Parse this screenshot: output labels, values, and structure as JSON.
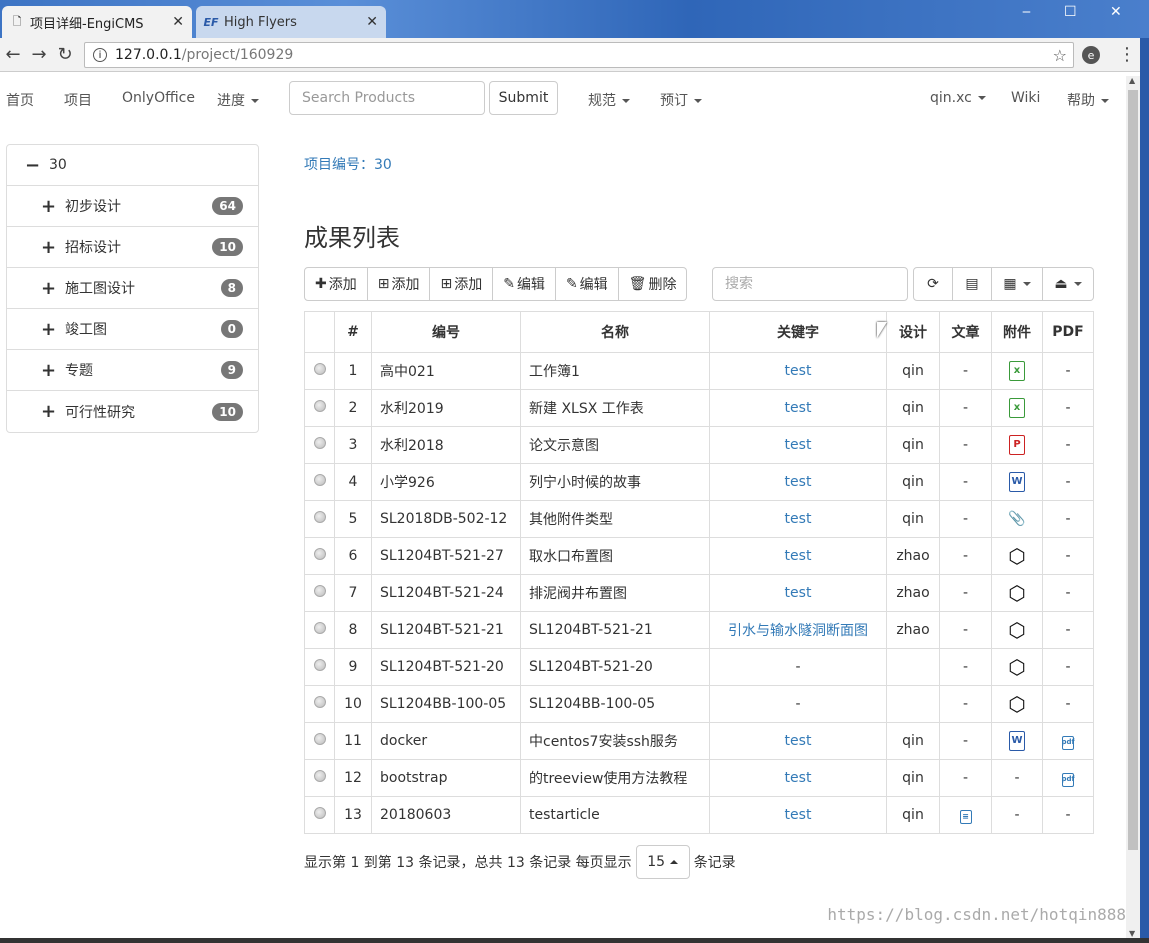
{
  "browser": {
    "tabs": [
      {
        "title": "项目详细-EngiCMS",
        "active": true
      },
      {
        "title": "High Flyers",
        "active": false
      }
    ],
    "url_host": "127.0.0.1",
    "url_path": "/project/160929"
  },
  "nav": {
    "home": "首页",
    "project": "项目",
    "onlyoffice": "OnlyOffice",
    "progress": "进度",
    "search_placeholder": "Search Products",
    "submit": "Submit",
    "standard": "规范",
    "reserve": "预订",
    "user": "qin.xc",
    "wiki": "Wiki",
    "help": "帮助"
  },
  "tree": {
    "root": "30",
    "children": [
      {
        "label": "初步设计",
        "count": "64"
      },
      {
        "label": "招标设计",
        "count": "10"
      },
      {
        "label": "施工图设计",
        "count": "8"
      },
      {
        "label": "竣工图",
        "count": "0"
      },
      {
        "label": "专题",
        "count": "9"
      },
      {
        "label": "可行性研究",
        "count": "10"
      }
    ]
  },
  "main": {
    "project_no": "项目编号：30",
    "heading": "成果列表",
    "toolbar": {
      "add1": "添加",
      "add2": "添加",
      "add3": "添加",
      "edit1": "编辑",
      "edit2": "编辑",
      "delete": "删除",
      "search_placeholder": "搜索"
    },
    "columns": [
      "#",
      "编号",
      "名称",
      "关键字",
      "设计",
      "文章",
      "附件",
      "PDF"
    ],
    "rows": [
      {
        "n": "1",
        "code": "高中021",
        "name": "工作簿1",
        "kw": "test",
        "designer": "qin",
        "article": "-",
        "att": "xlsx",
        "pdf": "-"
      },
      {
        "n": "2",
        "code": "水利2019",
        "name": "新建 XLSX 工作表",
        "kw": "test",
        "designer": "qin",
        "article": "-",
        "att": "xlsx",
        "pdf": "-"
      },
      {
        "n": "3",
        "code": "水利2018",
        "name": "论文示意图",
        "kw": "test",
        "designer": "qin",
        "article": "-",
        "att": "pptx",
        "pdf": "-"
      },
      {
        "n": "4",
        "code": "小学926",
        "name": "列宁小时候的故事",
        "kw": "test",
        "designer": "qin",
        "article": "-",
        "att": "docx",
        "pdf": "-"
      },
      {
        "n": "5",
        "code": "SL2018DB-502-12",
        "name": "其他附件类型",
        "kw": "test",
        "designer": "qin",
        "article": "-",
        "att": "clip",
        "pdf": "-"
      },
      {
        "n": "6",
        "code": "SL1204BT-521-27",
        "name": "取水口布置图",
        "kw": "test",
        "designer": "zhao",
        "article": "-",
        "att": "cube",
        "pdf": "-"
      },
      {
        "n": "7",
        "code": "SL1204BT-521-24",
        "name": "排泥阀井布置图",
        "kw": "test",
        "designer": "zhao",
        "article": "-",
        "att": "cube",
        "pdf": "-"
      },
      {
        "n": "8",
        "code": "SL1204BT-521-21",
        "name": "SL1204BT-521-21",
        "kw": "引水与输水隧洞断面图",
        "designer": "zhao",
        "article": "-",
        "att": "cube",
        "pdf": "-"
      },
      {
        "n": "9",
        "code": "SL1204BT-521-20",
        "name": "SL1204BT-521-20",
        "kw": "-",
        "designer": "",
        "article": "-",
        "att": "cube",
        "pdf": "-"
      },
      {
        "n": "10",
        "code": "SL1204BB-100-05",
        "name": "SL1204BB-100-05",
        "kw": "-",
        "designer": "",
        "article": "-",
        "att": "cube",
        "pdf": "-"
      },
      {
        "n": "11",
        "code": "docker",
        "name": "中centos7安装ssh服务",
        "kw": "test",
        "designer": "qin",
        "article": "-",
        "att": "docx",
        "pdf": "pdf"
      },
      {
        "n": "12",
        "code": "bootstrap",
        "name": "的treeview使用方法教程",
        "kw": "test",
        "designer": "qin",
        "article": "-",
        "att": "-",
        "pdf": "pdf"
      },
      {
        "n": "13",
        "code": "20180603",
        "name": "testarticle",
        "kw": "test",
        "designer": "qin",
        "article": "doc",
        "att": "-",
        "pdf": "-"
      }
    ],
    "footer": {
      "summary": "显示第 1 到第 13 条记录，总共 13 条记录 每页显示",
      "page_size": "15",
      "suffix": "条记录"
    }
  },
  "watermark": "https://blog.csdn.net/hotqin888"
}
